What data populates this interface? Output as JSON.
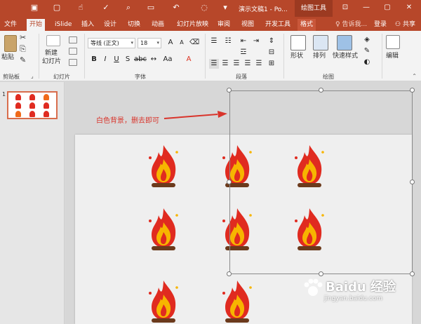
{
  "app": {
    "document_title": "演示文稿1 - Po...",
    "context_tab_group": "绘图工具"
  },
  "tabs": [
    {
      "label": "文件"
    },
    {
      "label": "开始"
    },
    {
      "label": "iSlide"
    },
    {
      "label": "插入"
    },
    {
      "label": "设计"
    },
    {
      "label": "切换"
    },
    {
      "label": "动画"
    },
    {
      "label": "幻灯片放映"
    },
    {
      "label": "审阅"
    },
    {
      "label": "视图"
    },
    {
      "label": "开发工具"
    },
    {
      "label": "格式"
    }
  ],
  "tell_me": "告诉我...",
  "signin": "登录",
  "share": "共享",
  "ribbon": {
    "paste": "粘贴",
    "new_slide_1": "新建",
    "new_slide_2": "幻灯片",
    "font_name": "等线 (正文)",
    "font_size": "18",
    "shape": "形状",
    "arrange": "排列",
    "quick_styles": "快速样式",
    "edit": "编辑",
    "groups": {
      "clipboard": "剪贴板",
      "slides": "幻灯片",
      "font": "字体",
      "paragraph": "段落",
      "drawing": "绘图"
    }
  },
  "slide_pane": {
    "slide_number": "1"
  },
  "annotation": "白色背景，删去即可",
  "watermark": {
    "title": "Baidu 经验",
    "url": "jingyan.baidu.com"
  },
  "colors": {
    "accent": "#b7472a",
    "annotation": "#d9342b",
    "flame_outer": "#e02b20",
    "flame_inner": "#f7b500",
    "log": "#6b3a1c"
  }
}
